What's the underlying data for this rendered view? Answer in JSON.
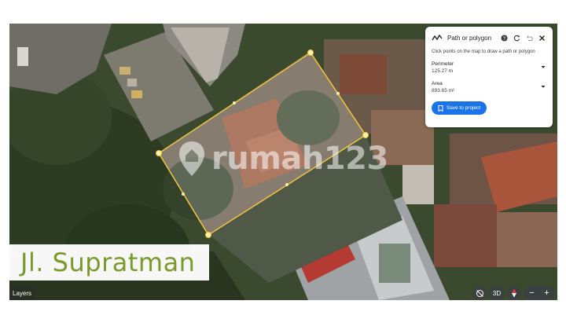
{
  "watermark": {
    "text": "rumah123"
  },
  "street_label": {
    "text": "Jl. Supratman"
  },
  "map_controls": {
    "layers_label": "Layers",
    "view_3d_label": "3D",
    "zoom_out_label": "−",
    "zoom_in_label": "+"
  },
  "measure_panel": {
    "title": "Path or polygon",
    "hint": "Click points on the map to draw a path or polygon",
    "perimeter_label": "Perimeter",
    "perimeter_value": "125.27 m",
    "area_label": "Area",
    "area_value": "893.65 m²",
    "save_button_label": "Save to project"
  },
  "colors": {
    "accent": "#1a73e8",
    "polygon_stroke": "#f2c53d",
    "street_label_text": "#7a9a2a"
  }
}
